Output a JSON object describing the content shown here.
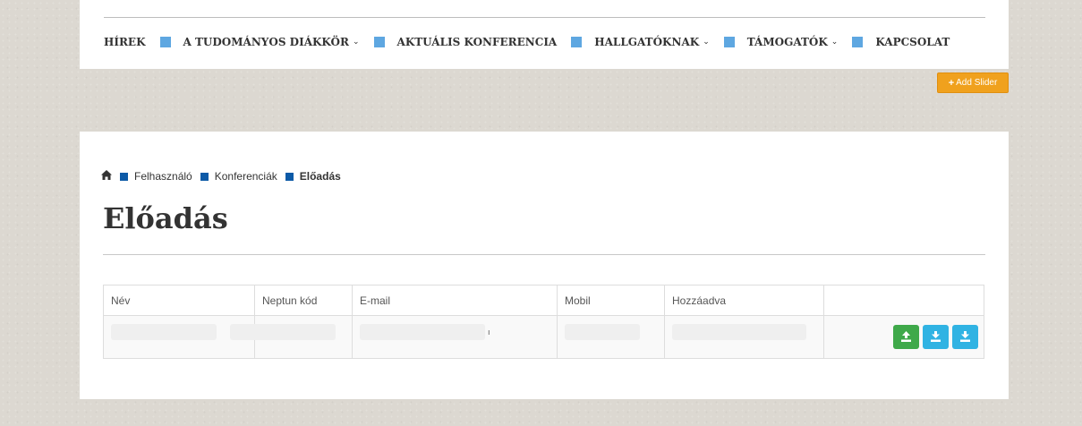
{
  "nav": {
    "items": [
      {
        "label": "HÍREK",
        "dropdown": false
      },
      {
        "label": "A TUDOMÁNYOS DIÁKKÖR",
        "dropdown": true
      },
      {
        "label": "AKTUÁLIS KONFERENCIA",
        "dropdown": false
      },
      {
        "label": "HALLGATÓKNAK",
        "dropdown": true
      },
      {
        "label": "TÁMOGATÓK",
        "dropdown": true
      },
      {
        "label": "KAPCSOLAT",
        "dropdown": false
      }
    ],
    "chevron": "⌄"
  },
  "add_slider": {
    "icon": "+",
    "label": "Add Slider",
    "color": "#f0a11d"
  },
  "breadcrumb": {
    "home_icon": "home-icon",
    "items": [
      "Felhasználó",
      "Konferenciák",
      "Előadás"
    ]
  },
  "page_title": "Előadás",
  "table": {
    "headers": [
      "Név",
      "Neptun kód",
      "E-mail",
      "Mobil",
      "Hozzáadva",
      ""
    ],
    "row_marker": "ı",
    "actions": [
      {
        "icon": "upload-icon",
        "color": "#3fa94a"
      },
      {
        "icon": "download-icon",
        "color": "#30b3e3"
      },
      {
        "icon": "download-icon",
        "color": "#30b3e3"
      }
    ]
  }
}
